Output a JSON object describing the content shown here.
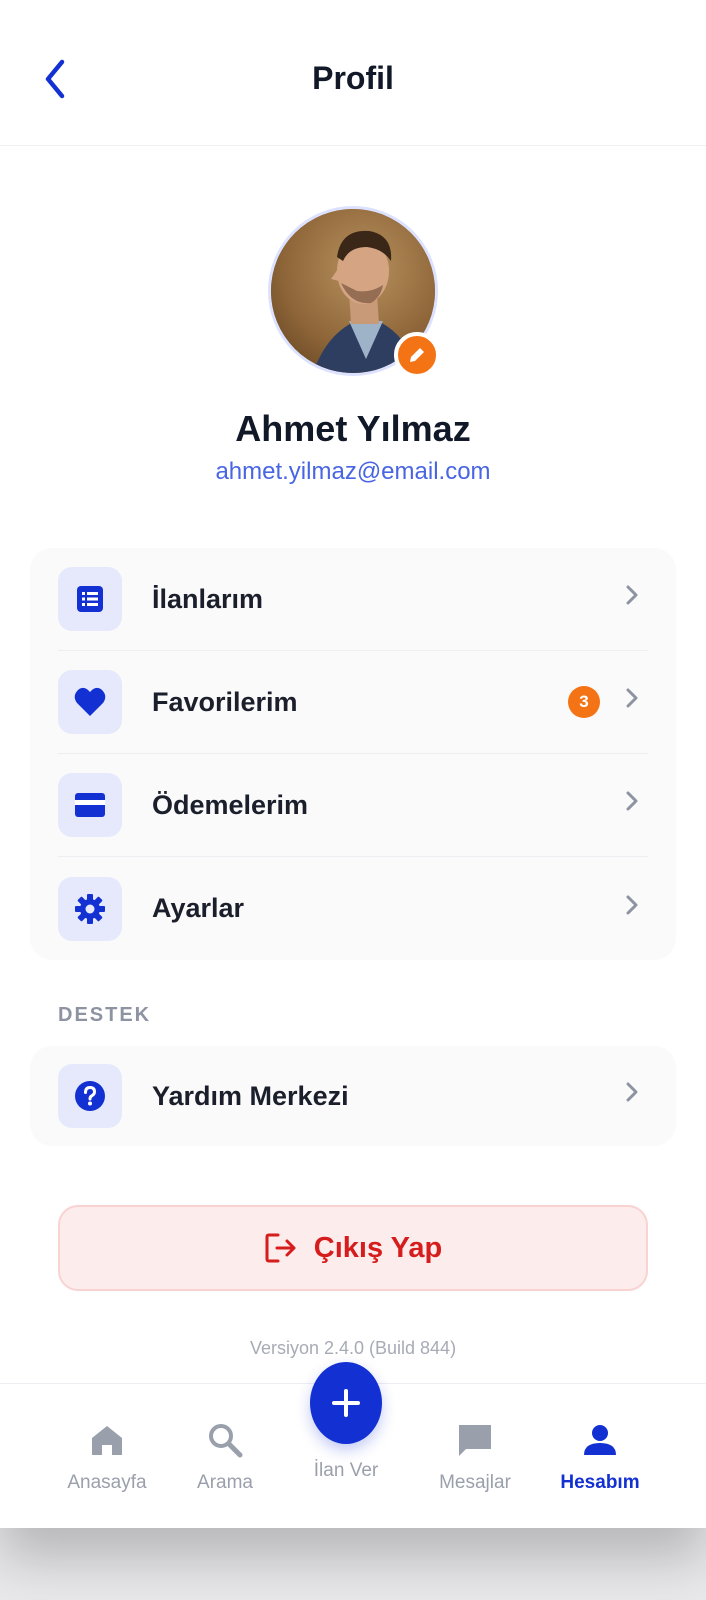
{
  "header": {
    "title": "Profil",
    "back_icon": "chevron-left-icon"
  },
  "profile": {
    "name": "Ahmet Yılmaz",
    "email": "ahmet.yilmaz@email.com",
    "avatar": "profile-photo",
    "edit_icon": "pencil-icon"
  },
  "menu": {
    "items": [
      {
        "label": "İlanlarım",
        "icon": "list-icon"
      },
      {
        "label": "Favorilerim",
        "icon": "heart-icon",
        "badge": "3"
      },
      {
        "label": "Ödemelerim",
        "icon": "credit-card-icon"
      },
      {
        "label": "Ayarlar",
        "icon": "gear-icon"
      }
    ]
  },
  "support": {
    "section_label": "DESTEK",
    "items": [
      {
        "label": "Yardım Merkezi",
        "icon": "help-circle-icon"
      }
    ]
  },
  "logout": {
    "label": "Çıkış Yap",
    "icon": "logout-icon"
  },
  "version": "Versiyon 2.4.0 (Build 844)",
  "bottom_nav": {
    "items": [
      {
        "label": "Anasayfa",
        "icon": "home-icon"
      },
      {
        "label": "Arama",
        "icon": "search-icon"
      },
      {
        "label": "İlan Ver",
        "icon": "plus-icon"
      },
      {
        "label": "Mesajlar",
        "icon": "message-icon"
      },
      {
        "label": "Hesabım",
        "icon": "person-icon",
        "active": true
      }
    ]
  },
  "colors": {
    "primary": "#1330d3",
    "accent": "#f47415",
    "danger": "#d61d1d",
    "email": "#4865e3"
  }
}
